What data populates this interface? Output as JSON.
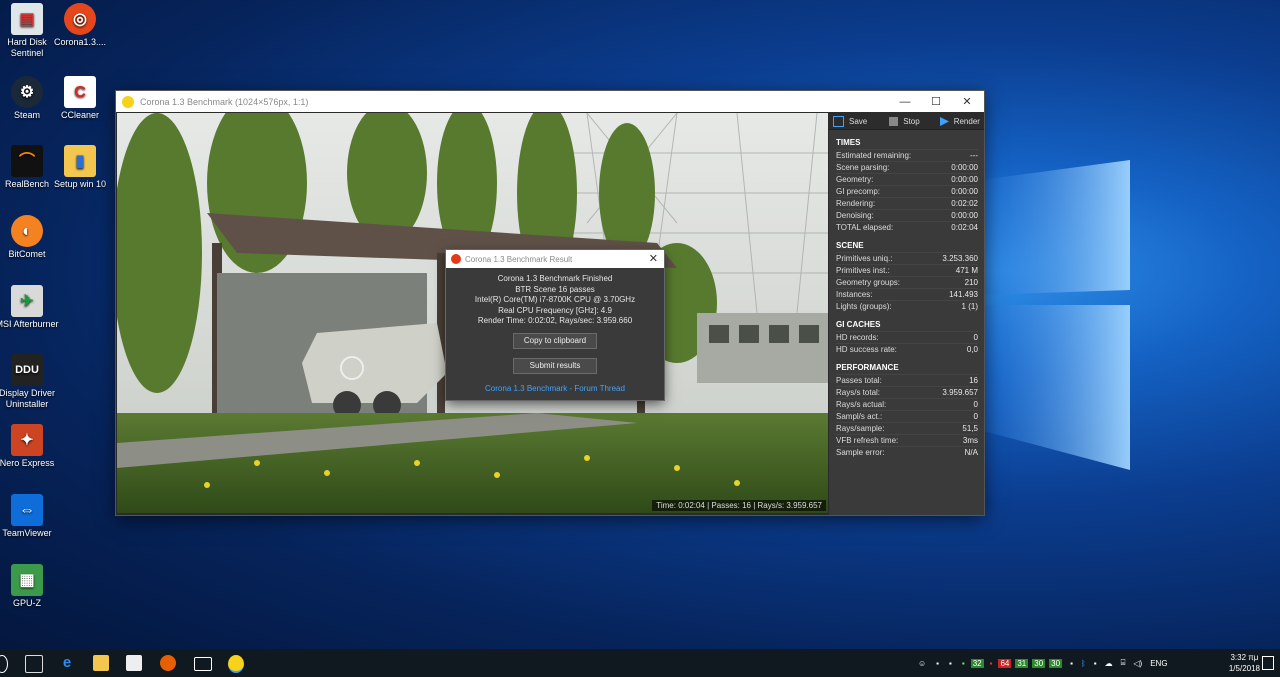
{
  "desktop_icons": [
    {
      "label": "Hard Disk Sentinel"
    },
    {
      "label": "Corona1.3...."
    },
    {
      "label": "Steam"
    },
    {
      "label": "CCleaner"
    },
    {
      "label": "RealBench"
    },
    {
      "label": "Setup win 10"
    },
    {
      "label": "BitComet"
    },
    {
      "label": "MSI Afterburner"
    },
    {
      "label": "Display Driver Uninstaller"
    },
    {
      "label": "Nero Express"
    },
    {
      "label": "TeamViewer"
    },
    {
      "label": "GPU-Z"
    }
  ],
  "window": {
    "title": "Corona 1.3 Benchmark (1024×576px, 1:1)",
    "status": "Time: 0:02:04 | Passes: 16 | Rays/s: 3.959.657",
    "toolbar": {
      "save": "Save",
      "stop": "Stop",
      "render": "Render"
    }
  },
  "panel": {
    "times": {
      "title": "TIMES",
      "rows": [
        {
          "k": "Estimated remaining:",
          "v": "---"
        },
        {
          "k": "Scene parsing:",
          "v": "0:00:00"
        },
        {
          "k": "Geometry:",
          "v": "0:00:00"
        },
        {
          "k": "GI precomp:",
          "v": "0:00:00"
        },
        {
          "k": "Rendering:",
          "v": "0:02:02"
        },
        {
          "k": "Denoising:",
          "v": "0:00:00"
        },
        {
          "k": "TOTAL elapsed:",
          "v": "0:02:04"
        }
      ]
    },
    "scene": {
      "title": "SCENE",
      "rows": [
        {
          "k": "Primitives uniq.:",
          "v": "3.253.360"
        },
        {
          "k": "Primitives inst.:",
          "v": "471 M"
        },
        {
          "k": "Geometry groups:",
          "v": "210"
        },
        {
          "k": "Instances:",
          "v": "141.493"
        },
        {
          "k": "Lights (groups):",
          "v": "1 (1)"
        }
      ]
    },
    "gi": {
      "title": "GI CACHES",
      "rows": [
        {
          "k": "HD records:",
          "v": "0"
        },
        {
          "k": "HD success rate:",
          "v": "0,0"
        }
      ]
    },
    "perf": {
      "title": "PERFORMANCE",
      "rows": [
        {
          "k": "Passes total:",
          "v": "16"
        },
        {
          "k": "Rays/s total:",
          "v": "3.959.657"
        },
        {
          "k": "Rays/s actual:",
          "v": "0"
        },
        {
          "k": "Sampl/s act.:",
          "v": "0"
        },
        {
          "k": "Rays/sample:",
          "v": "51,5"
        },
        {
          "k": "VFB refresh time:",
          "v": "3ms"
        },
        {
          "k": "Sample error:",
          "v": "N/A"
        }
      ]
    }
  },
  "dialog": {
    "title": "Corona 1.3 Benchmark Result",
    "line1": "Corona 1.3 Benchmark Finished",
    "line2": "BTR Scene 16 passes",
    "line3": "Intel(R) Core(TM) i7-8700K CPU @ 3.70GHz",
    "line4": "Real CPU Frequency [GHz]: 4.9",
    "line5": "Render Time: 0:02:02, Rays/sec: 3.959.660",
    "copy": "Copy to clipboard",
    "submit": "Submit results",
    "link": "Corona 1.3 Benchmark - Forum Thread"
  },
  "tray": {
    "temps": [
      "32",
      "64",
      "31",
      "30",
      "30"
    ],
    "lang": "ENG",
    "time": "3:32 πμ",
    "date": "1/5/2018"
  }
}
